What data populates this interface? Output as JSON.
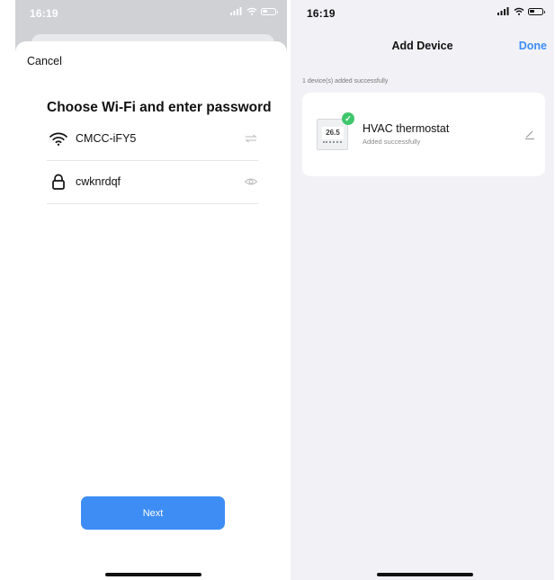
{
  "left_screen": {
    "status_bar": {
      "time": "16:19",
      "signal_icon": "cellular-signal-icon",
      "wifi_icon": "wifi-status-icon",
      "battery_icon": "battery-icon"
    },
    "cancel_label": "Cancel",
    "heading": "Choose Wi-Fi and enter password",
    "wifi": {
      "icon": "wifi-icon",
      "ssid": "CMCC-iFY5",
      "action_icon": "switch-network-icon"
    },
    "password": {
      "icon": "lock-icon",
      "value": "cwknrdqf",
      "action_icon": "eye-icon"
    },
    "next_label": "Next"
  },
  "right_screen": {
    "status_bar": {
      "time": "16:19",
      "signal_icon": "cellular-signal-icon",
      "wifi_icon": "wifi-status-icon",
      "battery_icon": "battery-icon"
    },
    "title": "Add Device",
    "done_label": "Done",
    "added_message": "1 device(s) added successfully",
    "device": {
      "name": "HVAC thermostat",
      "status": "Added successfully",
      "thumbnail_reading": "26.5",
      "badge_icon": "check-icon",
      "edit_icon": "pencil-icon"
    }
  },
  "colors": {
    "accent": "#3d8df5",
    "success": "#3fc76d",
    "backdrop": "#d0d1d5",
    "page_bg": "#f2f2f6"
  }
}
